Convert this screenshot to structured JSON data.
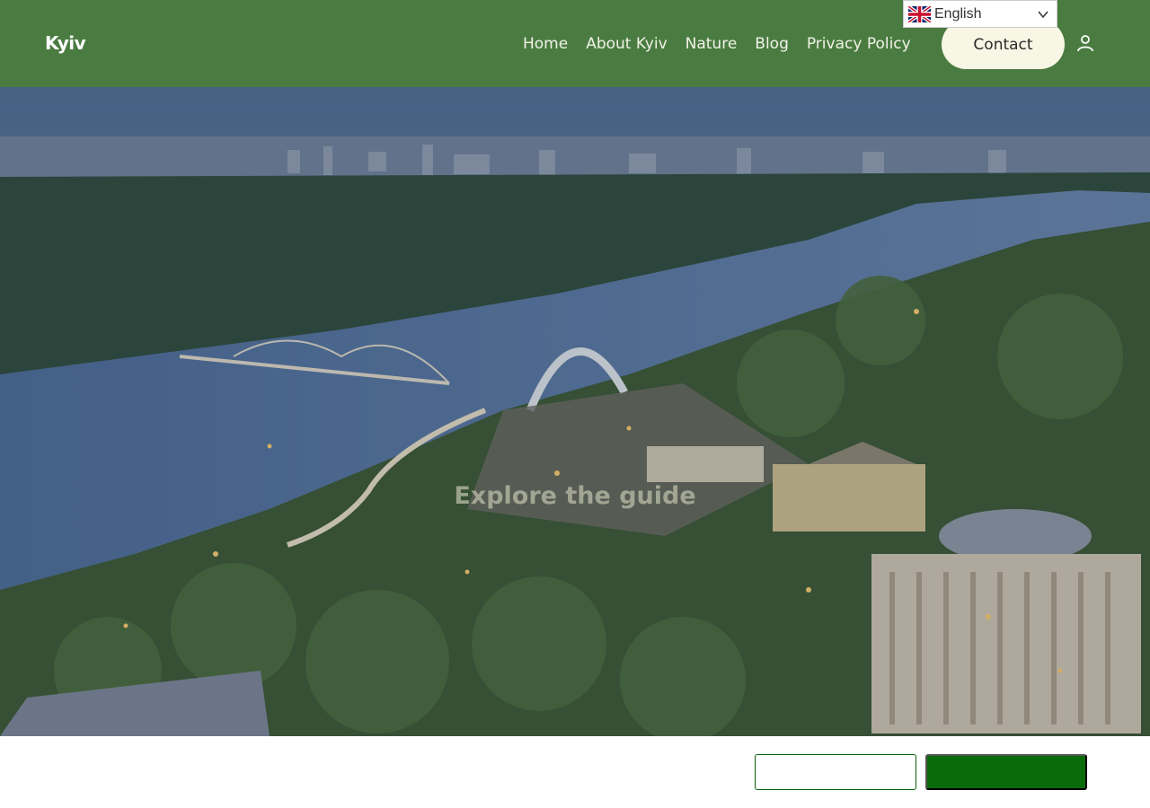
{
  "header": {
    "logo": "Kyiv",
    "nav": [
      "Home",
      "About Kyiv",
      "Nature",
      "Blog",
      "Privacy Policy"
    ],
    "contact_label": "Contact",
    "user_icon": "user-icon"
  },
  "language": {
    "selected": "English",
    "flag_icon": "uk-flag-icon"
  },
  "hero": {
    "title": "Explore the guide"
  },
  "consent": {
    "secondary_label": "",
    "primary_label": ""
  },
  "colors": {
    "header_bg": "#4a7c41",
    "contact_bg": "#f8f6e4",
    "primary_green": "#0a6b0a"
  }
}
